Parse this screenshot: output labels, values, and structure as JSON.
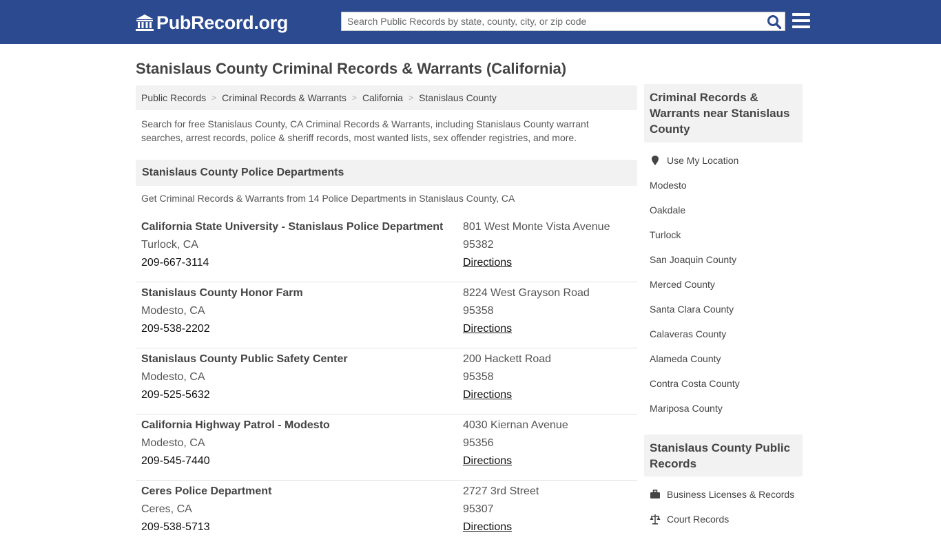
{
  "header": {
    "brand": "PubRecord.org",
    "search_placeholder": "Search Public Records by state, county, city, or zip code"
  },
  "page": {
    "title": "Stanislaus County Criminal Records & Warrants (California)",
    "breadcrumb": [
      "Public Records",
      "Criminal Records & Warrants",
      "California",
      "Stanislaus County"
    ],
    "intro": "Search for free Stanislaus County, CA Criminal Records & Warrants, including Stanislaus County warrant searches, arrest records, police & sheriff records, most wanted lists, sex offender registries, and more."
  },
  "departments": {
    "heading": "Stanislaus County Police Departments",
    "subheading": "Get Criminal Records & Warrants from 14 Police Departments in Stanislaus County, CA",
    "directions_label": "Directions",
    "items": [
      {
        "name": "California State University - Stanislaus Police Department",
        "city": "Turlock, CA",
        "phone": "209-667-3114",
        "street": "801 West Monte Vista Avenue",
        "zip": "95382"
      },
      {
        "name": "Stanislaus County Honor Farm",
        "city": "Modesto, CA",
        "phone": "209-538-2202",
        "street": "8224 West Grayson Road",
        "zip": "95358"
      },
      {
        "name": "Stanislaus County Public Safety Center",
        "city": "Modesto, CA",
        "phone": "209-525-5632",
        "street": "200 Hackett Road",
        "zip": "95358"
      },
      {
        "name": "California Highway Patrol - Modesto",
        "city": "Modesto, CA",
        "phone": "209-545-7440",
        "street": "4030 Kiernan Avenue",
        "zip": "95356"
      },
      {
        "name": "Ceres Police Department",
        "city": "Ceres, CA",
        "phone": "209-538-5713",
        "street": "2727 3rd Street",
        "zip": "95307"
      }
    ]
  },
  "sidebar": {
    "nearby_title": "Criminal Records & Warrants near Stanislaus County",
    "use_location": "Use My Location",
    "nearby": [
      "Modesto",
      "Oakdale",
      "Turlock",
      "San Joaquin County",
      "Merced County",
      "Santa Clara County",
      "Calaveras County",
      "Alameda County",
      "Contra Costa County",
      "Mariposa County"
    ],
    "public_title": "Stanislaus County Public Records",
    "public_links": [
      {
        "label": "Business Licenses & Records",
        "icon": "briefcase-icon"
      },
      {
        "label": "Court Records",
        "icon": "scales-icon"
      }
    ]
  },
  "colors": {
    "header_bg": "#2c4a8f",
    "panel_bg": "#f2f2f2",
    "search_icon": "#2c4a8f"
  }
}
